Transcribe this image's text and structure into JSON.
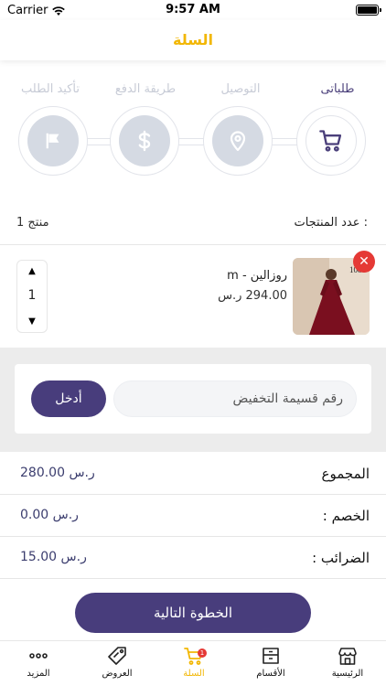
{
  "status_bar": {
    "carrier": "Carrier",
    "time": "9:57 AM"
  },
  "header": {
    "title": "السلة"
  },
  "steps": {
    "labels": [
      "طلباتى",
      "التوصيل",
      "طريقة الدفع",
      "تأكيد الطلب"
    ],
    "icons": [
      "cart-icon",
      "location-icon",
      "dollar-icon",
      "flag-icon"
    ],
    "active_index": 0
  },
  "cart": {
    "count_label": "عدد المنتجات :",
    "count_value": "1 منتج",
    "items": [
      {
        "name": "روزالين - m",
        "price": "294.00 ر.س",
        "quantity": "1",
        "thumb_text": "1081"
      }
    ]
  },
  "coupon": {
    "placeholder": "رقم قسيمة التخفيض",
    "apply_label": "أدخل"
  },
  "summary": [
    {
      "label": "المجموع",
      "amount": "280.00 ر.س"
    },
    {
      "label": "الخصم :",
      "amount": "0.00 ر.س"
    },
    {
      "label": "الضرائب :",
      "amount": "15.00 ر.س"
    }
  ],
  "next_button": "الخطوة التالية",
  "tab_bar": {
    "items": [
      {
        "label": "الرئيسية",
        "icon": "store-icon"
      },
      {
        "label": "الأقسام",
        "icon": "boxes-icon"
      },
      {
        "label": "السلة",
        "icon": "cart-icon",
        "badge": "1",
        "active": true
      },
      {
        "label": "العروض",
        "icon": "tag-icon"
      },
      {
        "label": "المزيد",
        "icon": "more-icon"
      }
    ]
  },
  "colors": {
    "accent": "#f2b705",
    "primary": "#483d7c",
    "danger": "#e53935",
    "inactive": "#d5dae3"
  }
}
